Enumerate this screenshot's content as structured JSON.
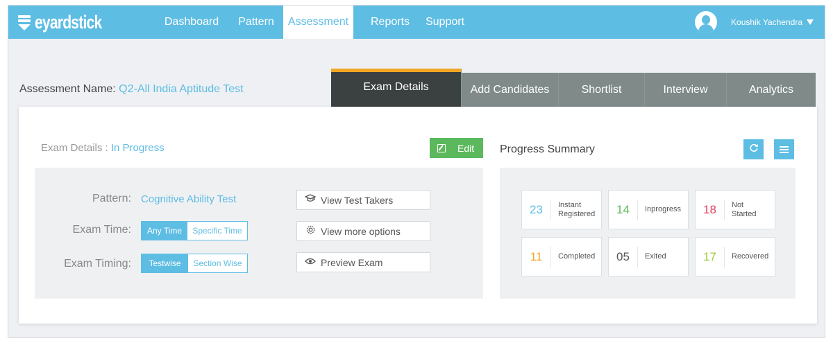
{
  "brand": {
    "name": "eyardstick"
  },
  "nav": {
    "items": [
      {
        "label": "Dashboard"
      },
      {
        "label": "Pattern"
      },
      {
        "label": "Assessment"
      },
      {
        "label": "Reports"
      },
      {
        "label": "Support"
      }
    ],
    "active": "Assessment"
  },
  "user": {
    "name": "Koushik Yachendra"
  },
  "assessment": {
    "label": "Assessment Name:",
    "name": "Q2-All India Aptitude Test"
  },
  "tabs": [
    {
      "label": "Exam Details"
    },
    {
      "label": "Add Candidates"
    },
    {
      "label": "Shortlist"
    },
    {
      "label": "Interview"
    },
    {
      "label": "Analytics"
    }
  ],
  "exam": {
    "title": "Exam Details",
    "separator": " : ",
    "status": "In Progress",
    "edit_label": "Edit",
    "pattern_label": "Pattern:",
    "pattern_value": "Cognitive Ability Test",
    "time_label": "Exam Time:",
    "time_options": [
      "Any Time",
      "Specific Time"
    ],
    "timing_label": "Exam Timing:",
    "timing_options": [
      "Testwise",
      "Section Wise"
    ],
    "actions": [
      {
        "label": "View Test Takers",
        "icon": "graduation-cap-icon"
      },
      {
        "label": "View more options",
        "icon": "gear-icon"
      },
      {
        "label": "Preview Exam",
        "icon": "eye-icon"
      }
    ]
  },
  "progress": {
    "title": "Progress Summary",
    "stats": [
      {
        "value": "23",
        "label_line1": "Instant",
        "label_line2": "Registered",
        "color": "#5dbde3"
      },
      {
        "value": "14",
        "label_line1": "Inprogress",
        "label_line2": "",
        "color": "#5cb85c"
      },
      {
        "value": "18",
        "label_line1": "Not",
        "label_line2": "Started",
        "color": "#e0415e"
      },
      {
        "value": "11",
        "label_line1": "Completed",
        "label_line2": "",
        "color": "#f0a623"
      },
      {
        "value": "05",
        "label_line1": "Exited",
        "label_line2": "",
        "color": "#555555"
      },
      {
        "value": "17",
        "label_line1": "Recovered",
        "label_line2": "",
        "color": "#9ccc3d"
      }
    ]
  },
  "colors": {
    "primary": "#5dbde3",
    "edit": "#5cb85c",
    "tab_active": "#3b4040",
    "tab_accent": "#f0a623",
    "tab": "#7f8a89"
  }
}
